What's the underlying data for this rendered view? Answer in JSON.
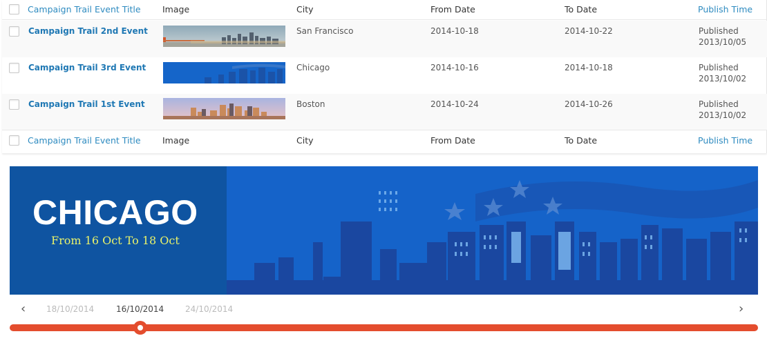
{
  "table": {
    "columns": {
      "title": "Campaign Trail Event Title",
      "image": "Image",
      "city": "City",
      "from": "From Date",
      "to": "To Date",
      "publish": "Publish Time"
    },
    "rows": [
      {
        "title": "Campaign Trail 2nd Event",
        "image": "san-francisco-skyline-thumbnail",
        "city": "San Francisco",
        "from": "2014-10-18",
        "to": "2014-10-22",
        "status": "Published",
        "date": "2013/10/05"
      },
      {
        "title": "Campaign Trail 3rd Event",
        "image": "chicago-skyline-thumbnail",
        "city": "Chicago",
        "from": "2014-10-16",
        "to": "2014-10-18",
        "status": "Published",
        "date": "2013/10/02"
      },
      {
        "title": "Campaign Trail 1st Event",
        "image": "boston-skyline-thumbnail",
        "city": "Boston",
        "from": "2014-10-24",
        "to": "2014-10-26",
        "status": "Published",
        "date": "2013/10/02"
      }
    ]
  },
  "banner": {
    "city": "CHICAGO",
    "dates": "From 16 Oct To 18 Oct",
    "image": "chicago-skyline-banner"
  },
  "timeline": {
    "prev_icon": "chevron-left-icon",
    "next_icon": "chevron-right-icon",
    "dates": [
      "18/10/2014",
      "16/10/2014",
      "24/10/2014"
    ],
    "active_index": 1,
    "prev_glyph": "‹",
    "next_glyph": "›",
    "accent": "#e44d2e"
  }
}
